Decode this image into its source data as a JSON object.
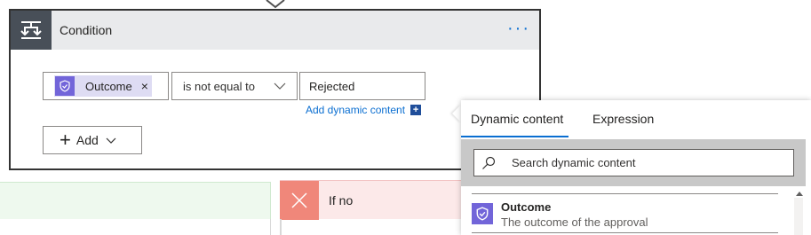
{
  "condition": {
    "title": "Condition",
    "menu": "···",
    "left_operand": {
      "token_label": "Outcome",
      "token_remove": "×"
    },
    "operator": {
      "selected": "is not equal to"
    },
    "right_operand": {
      "value": "Rejected"
    },
    "add_dynamic_content": "Add dynamic content",
    "add_dynamic_plus": "+",
    "add_button": {
      "plus": "+",
      "label": "Add"
    }
  },
  "branches": {
    "no": {
      "label": "If no"
    }
  },
  "dynamic_panel": {
    "tabs": [
      {
        "label": "Dynamic content",
        "active": true
      },
      {
        "label": "Expression",
        "active": false
      }
    ],
    "search": {
      "placeholder": "Search dynamic content"
    },
    "items": [
      {
        "title": "Outcome",
        "description": "The outcome of the approval",
        "icon": "approval-icon"
      }
    ]
  },
  "colors": {
    "accent": "#0a6ed1",
    "approval_icon_bg": "#7265d9",
    "token_bg": "#dedcf3",
    "no_branch_icon": "#f0877a",
    "yes_branch_bg": "#eef9ee",
    "no_branch_bg": "#fce9e9"
  }
}
